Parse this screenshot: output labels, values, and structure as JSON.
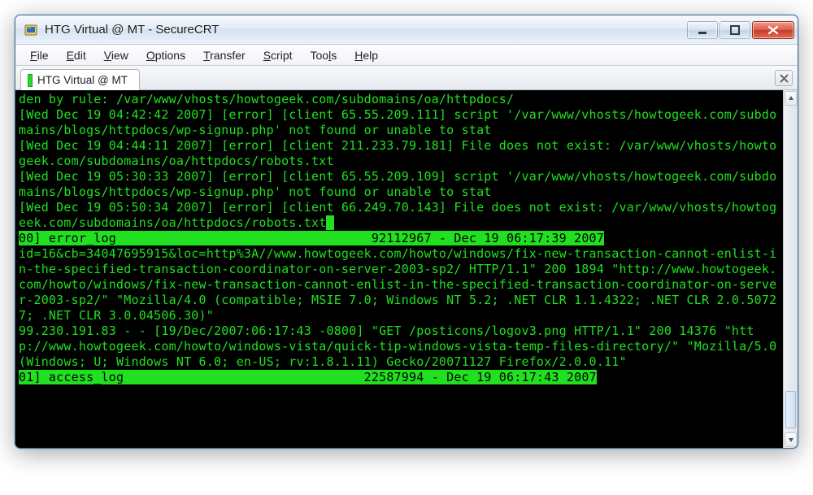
{
  "window": {
    "title": "HTG Virtual @ MT - SecureCRT"
  },
  "menu": {
    "file": "File",
    "edit": "Edit",
    "view": "View",
    "options": "Options",
    "transfer": "Transfer",
    "script": "Script",
    "tools": "Tools",
    "help": "Help"
  },
  "tabs": {
    "active": "HTG Virtual @ MT"
  },
  "terminal": {
    "body1": "den by rule: /var/www/vhosts/howtogeek.com/subdomains/oa/httpdocs/\n[Wed Dec 19 04:42:42 2007] [error] [client 65.55.209.111] script '/var/www/vhosts/howtogeek.com/subdomains/blogs/httpdocs/wp-signup.php' not found or unable to stat\n[Wed Dec 19 04:44:11 2007] [error] [client 211.233.79.181] File does not exist: /var/www/vhosts/howtogeek.com/subdomains/oa/httpdocs/robots.txt\n[Wed Dec 19 05:30:33 2007] [error] [client 65.55.209.109] script '/var/www/vhosts/howtogeek.com/subdomains/blogs/httpdocs/wp-signup.php' not found or unable to stat\n[Wed Dec 19 05:50:34 2007] [error] [client 66.249.70.143] File does not exist: /var/www/vhosts/howtogeek.com/subdomains/oa/httpdocs/robots.txt",
    "status1_left": "00] error_log",
    "status1_right": "92112967 - Dec 19 06:17:39 2007",
    "body2": "id=16&cb=34047695915&loc=http%3A//www.howtogeek.com/howto/windows/fix-new-transaction-cannot-enlist-in-the-specified-transaction-coordinator-on-server-2003-sp2/ HTTP/1.1\" 200 1894 \"http://www.howtogeek.com/howto/windows/fix-new-transaction-cannot-enlist-in-the-specified-transaction-coordinator-on-server-2003-sp2/\" \"Mozilla/4.0 (compatible; MSIE 7.0; Windows NT 5.2; .NET CLR 1.1.4322; .NET CLR 2.0.50727; .NET CLR 3.0.04506.30)\"\n99.230.191.83 - - [19/Dec/2007:06:17:43 -0800] \"GET /posticons/logov3.png HTTP/1.1\" 200 14376 \"http://www.howtogeek.com/howto/windows-vista/quick-tip-windows-vista-temp-files-directory/\" \"Mozilla/5.0 (Windows; U; Windows NT 6.0; en-US; rv:1.8.1.11) Gecko/20071127 Firefox/2.0.0.11\"",
    "status2_left": "01] access_log",
    "status2_right": "22587994 - Dec 19 06:17:43 2007"
  }
}
